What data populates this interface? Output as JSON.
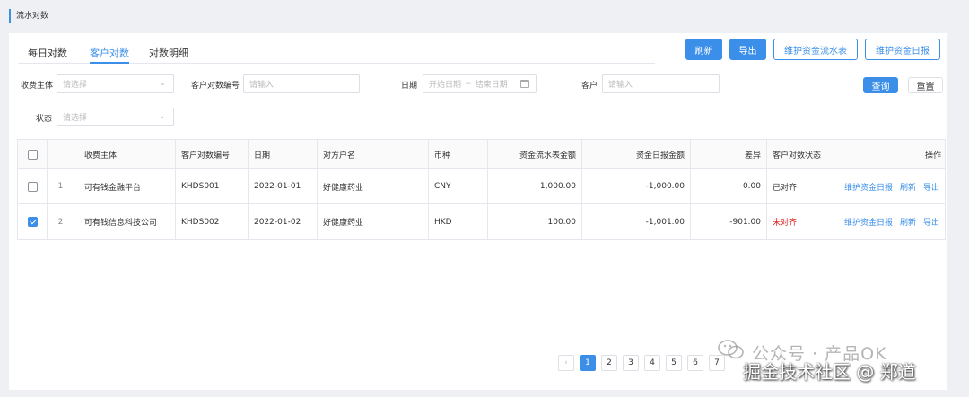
{
  "page_title": "流水对数",
  "tabs": [
    {
      "label": "每日对数"
    },
    {
      "label": "客户对数"
    },
    {
      "label": "对数明细"
    }
  ],
  "toolbar": {
    "refresh": "刷新",
    "export": "导出",
    "maintain_flow": "维护资金流水表",
    "maintain_daily": "维护资金日报"
  },
  "filters": {
    "payee_label": "收费主体",
    "payee_placeholder": "请选择",
    "recon_no_label": "客户对数编号",
    "recon_no_placeholder": "请输入",
    "date_label": "日期",
    "date_start": "开始日期",
    "date_sep": "~",
    "date_end": "结束日期",
    "customer_label": "客户",
    "customer_placeholder": "请输入",
    "status_label": "状态",
    "status_placeholder": "请选择",
    "query": "查询",
    "reset": "重置"
  },
  "table": {
    "headers": {
      "payee": "收费主体",
      "recon_no": "客户对数编号",
      "date": "日期",
      "counterparty": "对方户名",
      "currency": "币种",
      "flow_amount": "资金流水表金额",
      "daily_amount": "资金日报金额",
      "diff": "差异",
      "status": "客户对数状态",
      "ops": "操作"
    },
    "rows": [
      {
        "index": "1",
        "payee": "可有钱金融平台",
        "recon_no": "KHDS001",
        "date": "2022-01-01",
        "counterparty": "好健康药业",
        "currency": "CNY",
        "flow_amount": "1,000.00",
        "daily_amount": "-1,000.00",
        "diff": "0.00",
        "status": "已对齐",
        "op1": "维护资金日报",
        "op2": "刷新",
        "op3": "导出"
      },
      {
        "index": "2",
        "payee": "可有钱信息科技公司",
        "recon_no": "KHDS002",
        "date": "2022-01-02",
        "counterparty": "好健康药业",
        "currency": "HKD",
        "flow_amount": "100.00",
        "daily_amount": "-1,001.00",
        "diff": "-901.00",
        "status": "未对齐",
        "op1": "维护资金日报",
        "op2": "刷新",
        "op3": "导出"
      }
    ]
  },
  "pagination": {
    "prev": "‹",
    "pages": [
      "1",
      "2",
      "3",
      "4",
      "5",
      "6",
      "7"
    ]
  },
  "watermark": {
    "line1": "公众号 · 产品OK",
    "line2": "掘金技术社区 @ 郑道"
  },
  "colors": {
    "accent": "#3b8fe8",
    "danger": "#e02020"
  }
}
